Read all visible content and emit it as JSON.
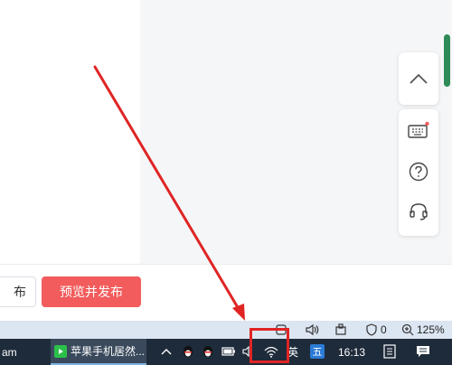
{
  "editor": {
    "action_bar": {
      "back_label": "布",
      "publish_label": "预览并发布",
      "publish_color": "#f25c5c"
    }
  },
  "right_tools": {
    "icons": [
      "chevron-up-icon",
      "keyboard-icon",
      "help-icon",
      "headset-icon"
    ]
  },
  "status_bar": {
    "shield_count": "0",
    "zoom": "125%"
  },
  "taskbar": {
    "left_app_label": "am",
    "wechat_task_label": "苹果手机居然...",
    "ime_lang": "英",
    "ime_mode": "五",
    "time": "16:13"
  },
  "annotation": {
    "color": "#e02424"
  }
}
